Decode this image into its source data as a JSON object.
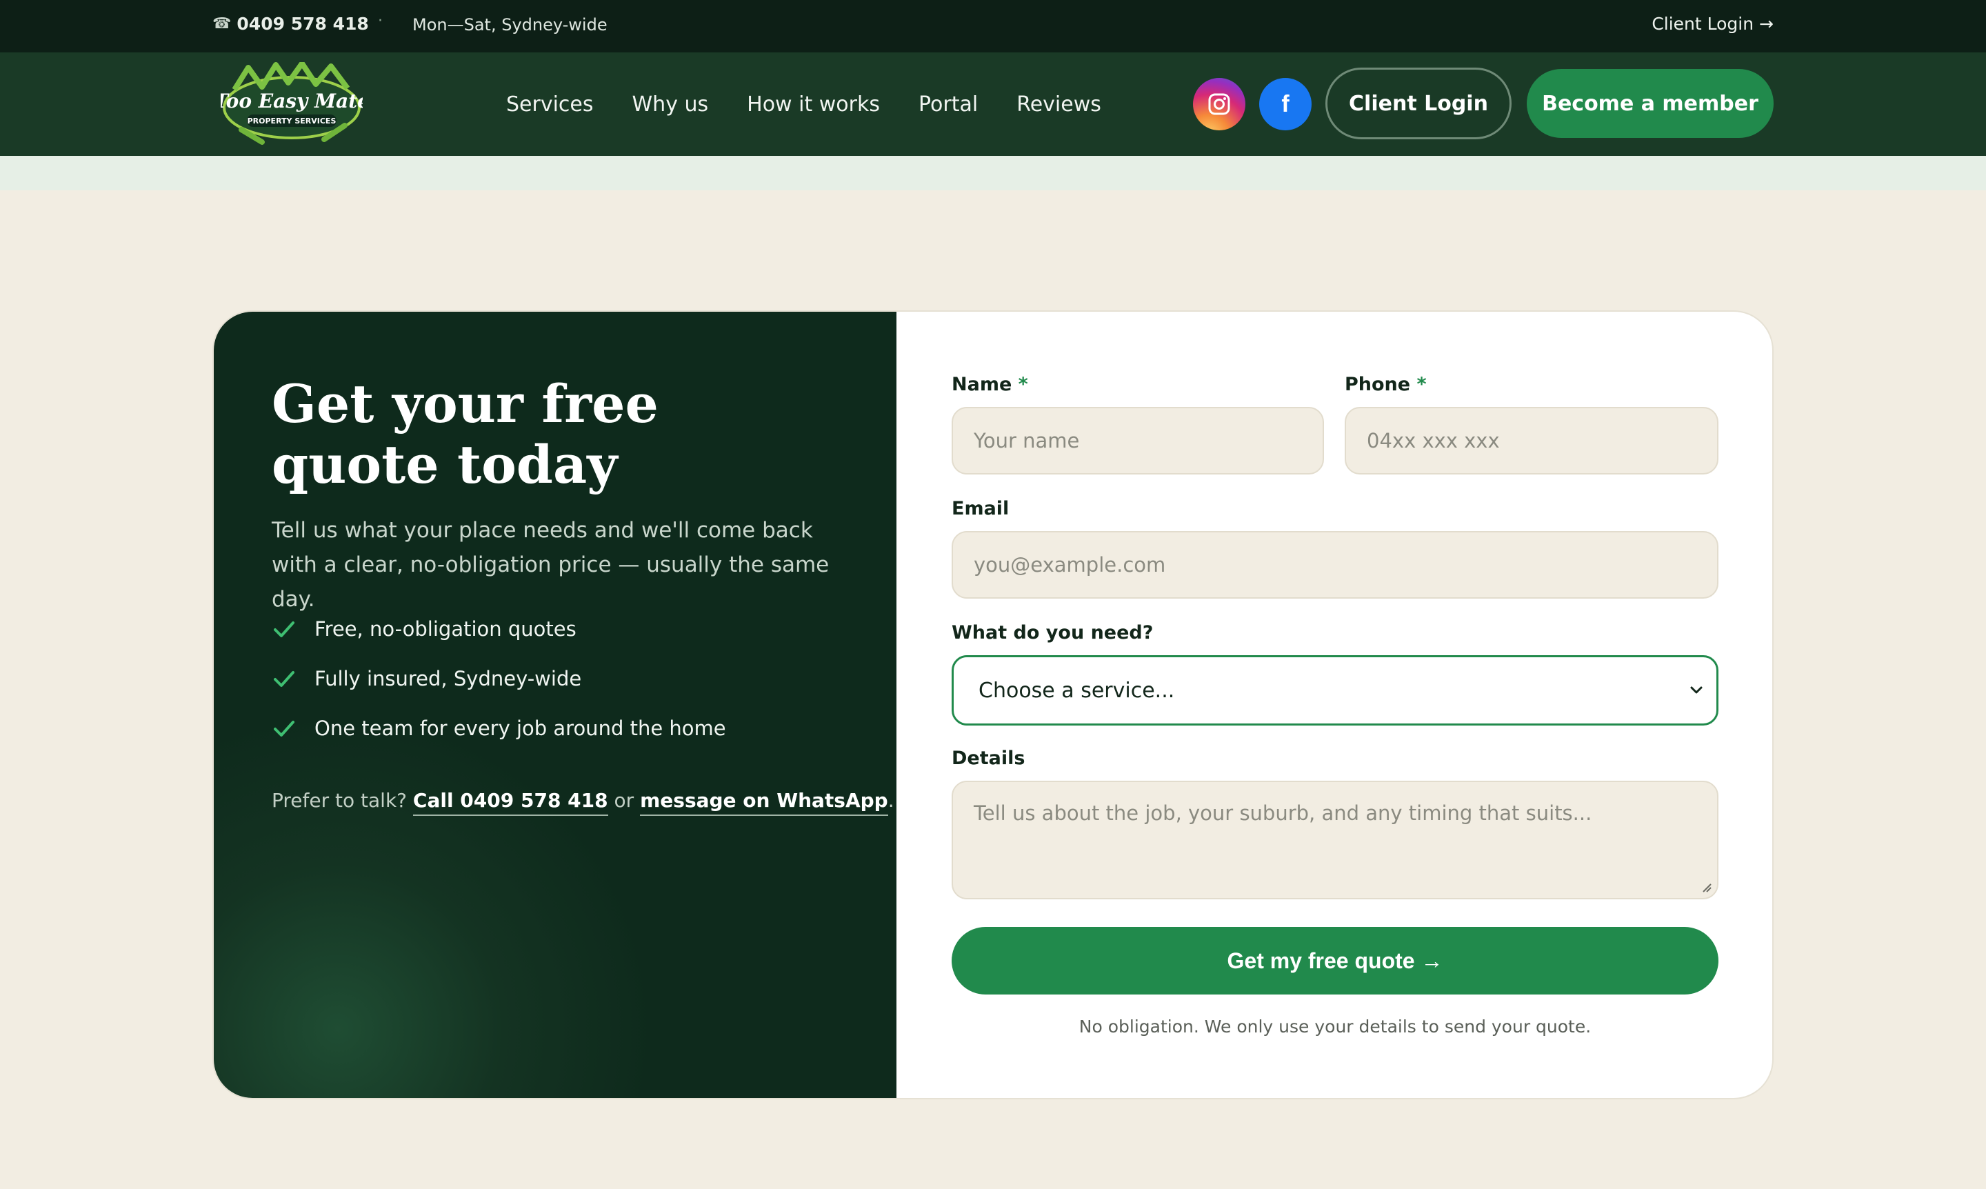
{
  "topbar": {
    "phone": "0409 578 418",
    "separator": "·",
    "hours": "Mon—Sat, Sydney-wide",
    "client_login": "Client Login →"
  },
  "nav": {
    "logo_text": "Too Easy Mate",
    "logo_subtext": "PROPERTY SERVICES",
    "links": [
      "Services",
      "Why us",
      "How it works",
      "Portal",
      "Reviews"
    ],
    "social_facebook_glyph": "f",
    "client_login": "Client Login",
    "become_member": "Become a member"
  },
  "quote": {
    "title": "Get your free quote today",
    "lede": "Tell us what your place needs and we'll come back with a clear, no-obligation price — usually the same day.",
    "benefits": [
      "Free, no-obligation quotes",
      "Fully insured, Sydney-wide",
      "One team for every job around the home"
    ],
    "talk_prefix": "Prefer to talk?",
    "call_link": "Call 0409 578 418",
    "talk_or": "or",
    "whatsapp_link": "message on WhatsApp",
    "talk_suffix": "."
  },
  "form": {
    "name_label": "Name",
    "name_placeholder": "Your name",
    "phone_label": "Phone",
    "phone_placeholder": "04xx xxx xxx",
    "required_mark": "*",
    "email_label": "Email",
    "email_placeholder": "you@example.com",
    "service_label": "What do you need?",
    "service_selected": "Choose a service...",
    "details_label": "Details",
    "details_placeholder": "Tell us about the job, your suburb, and any timing that suits...",
    "submit": "Get my free quote →",
    "note": "No obligation. We only use your details to send your quote."
  },
  "colors": {
    "brand_green": "#218a4c",
    "dark_green": "#0e2a1c",
    "nav_green": "#1a3a26",
    "cream": "#f2ede2"
  }
}
